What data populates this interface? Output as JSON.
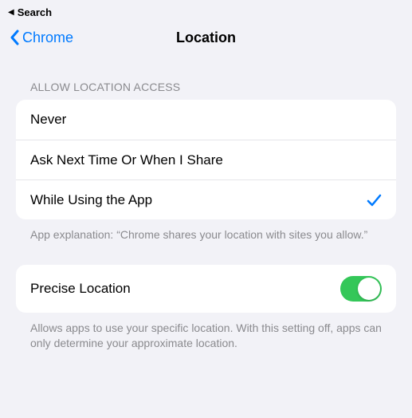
{
  "breadcrumb": {
    "label": "Search"
  },
  "nav": {
    "back_label": "Chrome",
    "title": "Location"
  },
  "access_section": {
    "header": "ALLOW LOCATION ACCESS",
    "options": [
      {
        "label": "Never",
        "selected": false
      },
      {
        "label": "Ask Next Time Or When I Share",
        "selected": false
      },
      {
        "label": "While Using the App",
        "selected": true
      }
    ],
    "footer": "App explanation: “Chrome shares your location with sites you allow.”"
  },
  "precise_section": {
    "label": "Precise Location",
    "enabled": true,
    "footer": "Allows apps to use your specific location. With this setting off, apps can only determine your approximate location."
  },
  "colors": {
    "accent": "#007aff",
    "toggle_on": "#34c759",
    "bg": "#f2f2f7",
    "secondary_text": "#8a8a8e"
  }
}
